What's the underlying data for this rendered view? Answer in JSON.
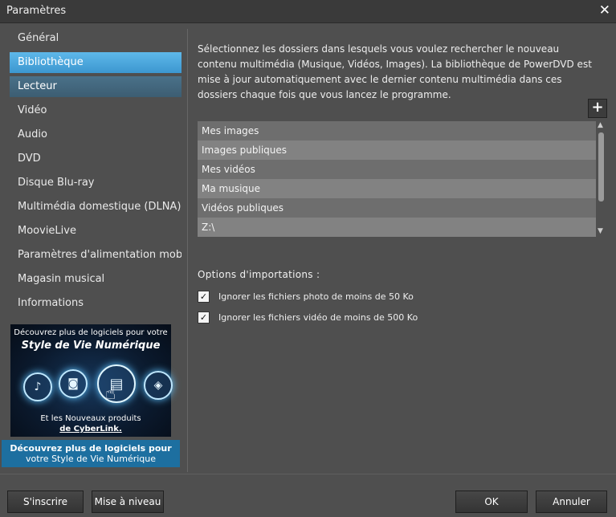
{
  "window": {
    "title": "Paramètres"
  },
  "sidebar": {
    "items": [
      {
        "label": "Général"
      },
      {
        "label": "Bibliothèque"
      },
      {
        "label": "Lecteur"
      },
      {
        "label": "Vidéo"
      },
      {
        "label": "Audio"
      },
      {
        "label": "DVD"
      },
      {
        "label": "Disque Blu-ray"
      },
      {
        "label": "Multimédia domestique (DLNA)"
      },
      {
        "label": "MoovieLive"
      },
      {
        "label": "Paramètres d'alimentation mobi"
      },
      {
        "label": "Magasin musical"
      },
      {
        "label": "Informations"
      }
    ]
  },
  "ad": {
    "top": "Découvrez plus de logiciels pour votre",
    "headline": "Style de Vie Numérique",
    "bottom1": "Et les Nouveaux produits",
    "bottom2": "de CyberLink.",
    "caption_line1": "Découvrez plus de logiciels pour",
    "caption_line2": "votre Style de Vie Numérique"
  },
  "main": {
    "description": "Sélectionnez les dossiers dans lesquels vous voulez rechercher le nouveau contenu multimédia (Musique, Vidéos, Images). La bibliothèque de PowerDVD est mise à jour automatiquement avec le dernier contenu multimédia dans ces dossiers chaque fois que vous lancez le programme.",
    "add_label": "+",
    "folders": [
      "Mes images",
      "Images publiques",
      "Mes vidéos",
      "Ma musique",
      "Vidéos publiques",
      "Z:\\"
    ],
    "options_title": "Options  d'importations :",
    "option1": "Ignorer les fichiers photo de moins de 50 Ko",
    "option2": "Ignorer les fichiers vidéo de moins de 500 Ko"
  },
  "footer": {
    "register": "S'inscrire",
    "upgrade": "Mise à niveau",
    "ok": "OK",
    "cancel": "Annuler"
  }
}
